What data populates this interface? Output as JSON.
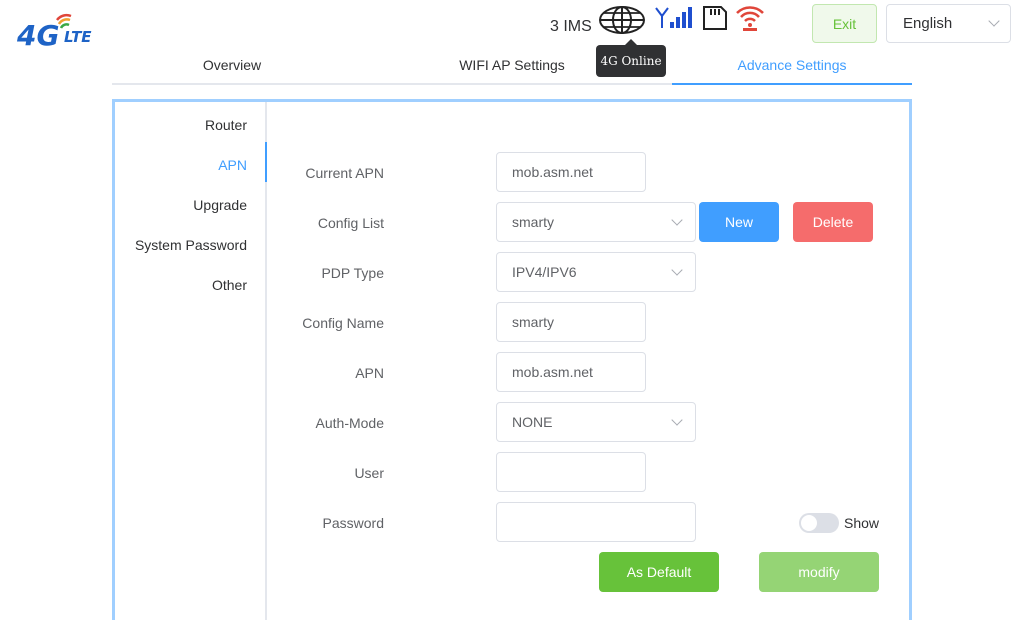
{
  "header": {
    "logo_main": "4G",
    "logo_sub": "LTE",
    "ims_status": "3 IMS",
    "network_tooltip": "4G Online",
    "exit_label": "Exit",
    "language": "English",
    "icons": [
      "globe-icon",
      "signal-icon",
      "sim-card-icon",
      "wifi-icon"
    ],
    "colors": {
      "signal": "#1f4fcf",
      "wifi": "#e0463a",
      "logo_blue": "#1e63c6"
    }
  },
  "tabs": [
    {
      "label": "Overview"
    },
    {
      "label": "WIFI AP Settings"
    },
    {
      "label": "Advance Settings",
      "active": true
    }
  ],
  "sidebar": {
    "items": [
      {
        "label": "Router"
      },
      {
        "label": "APN",
        "active": true
      },
      {
        "label": "Upgrade"
      },
      {
        "label": "System Password"
      },
      {
        "label": "Other"
      }
    ]
  },
  "form": {
    "current_apn": {
      "label": "Current APN",
      "value": "mob.asm.net"
    },
    "config_list": {
      "label": "Config List",
      "value": "smarty"
    },
    "pdp_type": {
      "label": "PDP Type",
      "value": "IPV4/IPV6"
    },
    "config_name": {
      "label": "Config Name",
      "value": "smarty"
    },
    "apn": {
      "label": "APN",
      "value": "mob.asm.net"
    },
    "auth_mode": {
      "label": "Auth-Mode",
      "value": "NONE"
    },
    "user": {
      "label": "User",
      "value": ""
    },
    "password": {
      "label": "Password",
      "value": ""
    },
    "show_label": "Show",
    "new_label": "New",
    "delete_label": "Delete",
    "default_label": "As Default",
    "modify_label": "modify"
  }
}
